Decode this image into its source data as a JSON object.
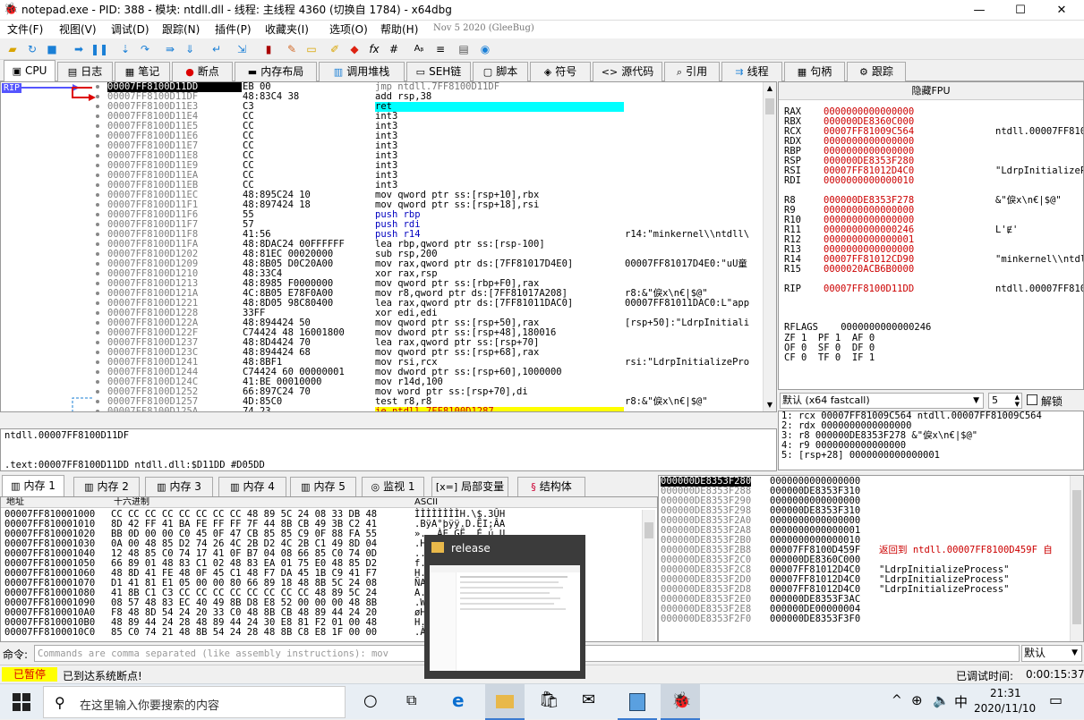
{
  "window": {
    "title": "notepad.exe - PID: 388 - 模块: ntdll.dll - 线程: 主线程 4360 (切换自 1784) - x64dbg",
    "minimize": "—",
    "maximize": "☐",
    "close": "✕"
  },
  "menu": [
    "文件(F)",
    "视图(V)",
    "调试(D)",
    "跟踪(N)",
    "插件(P)",
    "收藏夹(I)",
    "选项(O)",
    "帮助(H)"
  ],
  "build_date": "Nov 5 2020 (GleeBug)",
  "toolbar": [
    "open-folder-icon",
    "restart-icon",
    "stop-icon",
    "run-icon",
    "pause-icon",
    "step-into-icon",
    "step-over-icon",
    "trace-into-icon",
    "trace-over-icon",
    "execute-till-return-icon",
    "run-to-user-code-icon",
    "bookmark-icon",
    "comment-icon",
    "label-icon",
    "highlight-icon",
    "breakpoint-icon",
    "function-icon",
    "hash-icon",
    "font-icon",
    "align-icon",
    "script-icon",
    "calculator-icon"
  ],
  "tabs": [
    {
      "label": "CPU",
      "icon": "cpu-icon"
    },
    {
      "label": "日志",
      "icon": "log-icon"
    },
    {
      "label": "笔记",
      "icon": "notes-icon"
    },
    {
      "label": "断点",
      "icon": "breakpoint-icon"
    },
    {
      "label": "内存布局",
      "icon": "memory-map-icon"
    },
    {
      "label": "调用堆栈",
      "icon": "call-stack-icon"
    },
    {
      "label": "SEH链",
      "icon": "seh-icon"
    },
    {
      "label": "脚本",
      "icon": "script-icon"
    },
    {
      "label": "符号",
      "icon": "symbol-icon"
    },
    {
      "label": "源代码",
      "icon": "source-icon"
    },
    {
      "label": "引用",
      "icon": "references-icon"
    },
    {
      "label": "线程",
      "icon": "threads-icon"
    },
    {
      "label": "句柄",
      "icon": "handles-icon"
    },
    {
      "label": "跟踪",
      "icon": "trace-icon"
    }
  ],
  "cpu": {
    "rip_label": "RIP",
    "addresses": [
      "00007FF8100D11DD",
      "00007FF8100D11DF",
      "00007FF8100D11E3",
      "00007FF8100D11E4",
      "00007FF8100D11E5",
      "00007FF8100D11E6",
      "00007FF8100D11E7",
      "00007FF8100D11E8",
      "00007FF8100D11E9",
      "00007FF8100D11EA",
      "00007FF8100D11EB",
      "00007FF8100D11EC",
      "00007FF8100D11F1",
      "00007FF8100D11F6",
      "00007FF8100D11F7",
      "00007FF8100D11F8",
      "00007FF8100D11FA",
      "00007FF8100D1202",
      "00007FF8100D1209",
      "00007FF8100D1210",
      "00007FF8100D1213",
      "00007FF8100D121A",
      "00007FF8100D1221",
      "00007FF8100D1228",
      "00007FF8100D122A",
      "00007FF8100D122F",
      "00007FF8100D1237",
      "00007FF8100D123C",
      "00007FF8100D1241",
      "00007FF8100D1244",
      "00007FF8100D124C",
      "00007FF8100D1252",
      "00007FF8100D1257",
      "00007FF8100D125A"
    ],
    "bytes": [
      "EB 00",
      "48:83C4 38",
      "C3",
      "CC",
      "CC",
      "CC",
      "CC",
      "CC",
      "CC",
      "CC",
      "CC",
      "48:895C24 10",
      "48:897424 18",
      "55",
      "57",
      "41:56",
      "48:8DAC24 00FFFFFF",
      "48:81EC 00020000",
      "48:8B05 D0C20A00",
      "48:33C4",
      "48:8985 F0000000",
      "4C:8B05 E78F0A00",
      "48:8D05 98C80400",
      "33FF",
      "48:894424 50",
      "C74424 48 16001800",
      "48:8D4424 70",
      "48:894424 68",
      "48:8BF1",
      "C74424 60 00000001",
      "41:BE 00010000",
      "66:897C24 70",
      "4D:85C0",
      "74 23"
    ],
    "disasm": [
      "jmp ntdll.7FF8100D11DF",
      "add rsp,38",
      "ret",
      "int3",
      "int3",
      "int3",
      "int3",
      "int3",
      "int3",
      "int3",
      "int3",
      "mov qword ptr ss:[rsp+10],rbx",
      "mov qword ptr ss:[rsp+18],rsi",
      "push rbp",
      "push rdi",
      "push r14",
      "lea rbp,qword ptr ss:[rsp-100]",
      "sub rsp,200",
      "mov rax,qword ptr ds:[7FF81017D4E0]",
      "xor rax,rsp",
      "mov qword ptr ss:[rbp+F0],rax",
      "mov r8,qword ptr ds:[7FF81017A208]",
      "lea rax,qword ptr ds:[7FF81011DAC0]",
      "xor edi,edi",
      "mov qword ptr ss:[rsp+50],rax",
      "mov dword ptr ss:[rsp+48],180016",
      "lea rax,qword ptr ss:[rsp+70]",
      "mov qword ptr ss:[rsp+68],rax",
      "mov rsi,rcx",
      "mov dword ptr ss:[rsp+60],1000000",
      "mov r14d,100",
      "mov word ptr ss:[rsp+70],di",
      "test r8,r8",
      "je ntdll.7FF8100D1287"
    ],
    "comments": [
      "",
      "",
      "",
      "",
      "",
      "",
      "",
      "",
      "",
      "",
      "",
      "",
      "",
      "",
      "",
      "r14:\"minkernel\\\\ntdll\\",
      "",
      "",
      "00007FF81017D4E0:\"uU童",
      "",
      "",
      "r8:&\"㑦x\\n€|$@\"",
      "00007FF81011DAC0:L\"app",
      "",
      "[rsp+50]:\"LdrpInitiali",
      "",
      "",
      "",
      "rsi:\"LdrpInitializePro",
      "",
      "",
      "",
      "r8:&\"㑦x\\n€|$@\"",
      ""
    ]
  },
  "fpu_header": "隐藏FPU",
  "registers": [
    {
      "n": "RAX",
      "v": "0000000000000000",
      "c": ""
    },
    {
      "n": "RBX",
      "v": "000000DE8360C000",
      "c": ""
    },
    {
      "n": "RCX",
      "v": "00007FF81009C564",
      "c": "ntdll.00007FF81009C"
    },
    {
      "n": "RDX",
      "v": "0000000000000000",
      "c": ""
    },
    {
      "n": "RBP",
      "v": "0000000000000000",
      "c": ""
    },
    {
      "n": "RSP",
      "v": "000000DE8353F280",
      "c": ""
    },
    {
      "n": "RSI",
      "v": "00007FF81012D4C0",
      "c": "\"LdrpInitializeProc"
    },
    {
      "n": "RDI",
      "v": "0000000000000010",
      "c": ""
    },
    {
      "n": "R8",
      "v": "000000DE8353F278",
      "c": "&\"㑦x\\n€|$@\""
    },
    {
      "n": "R9",
      "v": "0000000000000000",
      "c": ""
    },
    {
      "n": "R10",
      "v": "0000000000000000",
      "c": ""
    },
    {
      "n": "R11",
      "v": "0000000000000246",
      "c": "L'Ɇ'"
    },
    {
      "n": "R12",
      "v": "0000000000000001",
      "c": ""
    },
    {
      "n": "R13",
      "v": "0000000000000000",
      "c": ""
    },
    {
      "n": "R14",
      "v": "00007FF81012CD90",
      "c": "\"minkernel\\\\ntdll\\\\"
    },
    {
      "n": "R15",
      "v": "0000020ACB6B0000",
      "c": ""
    },
    {
      "n": "RIP",
      "v": "00007FF8100D11DD",
      "c": "ntdll.00007FF8100D1"
    }
  ],
  "rflags": {
    "label": "RFLAGS",
    "value": "0000000000000246",
    "flags": [
      "ZF 1  PF 1  AF 0",
      "OF 0  SF 0  DF 0",
      "CF 0  TF 0  IF 1"
    ]
  },
  "callconv": {
    "selected": "默认 (x64 fastcall)",
    "count": "5",
    "unlock_label": "解锁"
  },
  "args": [
    "1: rcx 00007FF81009C564 ntdll.00007FF81009C564",
    "2: rdx 0000000000000000",
    "3: r8 000000DE8353F278 &\"㑦x\\n€|$@\"",
    "4: r9 0000000000000000",
    "5: [rsp+28] 0000000000000001"
  ],
  "info": {
    "line1": "ntdll.00007FF8100D11DF",
    "line2": ".text:00007FF8100D11DD ntdll.dll:$D11DD #D05DD"
  },
  "memtabs": [
    {
      "label": "内存 1",
      "icon": "dump-icon"
    },
    {
      "label": "内存 2",
      "icon": "dump-icon"
    },
    {
      "label": "内存 3",
      "icon": "dump-icon"
    },
    {
      "label": "内存 4",
      "icon": "dump-icon"
    },
    {
      "label": "内存 5",
      "icon": "dump-icon"
    },
    {
      "label": "监视 1",
      "icon": "watch-icon"
    },
    {
      "label": "局部变量",
      "icon": "locals-icon"
    },
    {
      "label": "结构体",
      "icon": "struct-icon"
    }
  ],
  "dump": {
    "headers": [
      "地址",
      "十六进制",
      "ASCII"
    ],
    "addresses": [
      "00007FF810001000",
      "00007FF810001010",
      "00007FF810001020",
      "00007FF810001030",
      "00007FF810001040",
      "00007FF810001050",
      "00007FF810001060",
      "00007FF810001070",
      "00007FF810001080",
      "00007FF810001090",
      "00007FF8100010A0",
      "00007FF8100010B0",
      "00007FF8100010C0"
    ],
    "hex": [
      "CC CC CC CC CC CC CC CC 48 89 5C 24 08 33 DB 48",
      "8D 42 FF 41 BA FE FF FF 7F 44 8B CB 49 3B C2 41",
      "BB 0D 00 00 C0 45 0F 47 CB 85 85 C9 0F 88 FA 55",
      "0A 00 48 85 D2 74 26 4C 2B D2 4C 2B C1 49 8D 04",
      "12 48 85 C0 74 17 41 0F B7 04 08 66 85 C0 74 0D",
      "66 89 01 48 83 C1 02 48 83 EA 01 75 E0 48 85 D2",
      "48 8D 41 FE 48 0F 45 C1 48 F7 DA 45 1B C9 41 F7",
      "D1 41 81 E1 05 00 00 80 66 89 18 48 8B 5C 24 08",
      "41 8B C1 C3 CC CC CC CC CC CC CC CC 48 89 5C 24",
      "08 57 48 83 EC 40 49 8B D8 E8 52 00 00 00 48 8B",
      "F8 48 8D 54 24 20 33 C0 48 8B CB 48 89 44 24 20",
      "48 89 44 24 28 48 89 44 24 30 E8 81 F2 01 00 48",
      "85 C0 74 21 48 8B 54 24 28 48 8B C8 E8 1F 00 00"
    ],
    "ascii": [
      "ÌÌÌÌÌÌÌÌH.\\$.3ÛH",
      ".BÿA°þÿÿ.D.ËI;ÂA",
      "»...ÀE.GË..É.ú U",
      ".H.ÒtóL+ÒL+ÁI..",
      "..H.Àt.A.·..f.Àt",
      "f..H.Á.H.ê.uàH.Ò",
      "H.AþH.EÁH÷ÚE.ÉA÷",
      "ÑA.á...f..H.\\$.",
      "A.ÁÃÌÌÌÌÌÌÌÌH.\\$",
      ".WH.ì@I.Øè R...H.",
      "øH.T$ 3ÀH.ËH.D$ ",
      "H.D$(H.D$0è.ò..H",
      ".Àt!H.T$(H.Èè..."
    ]
  },
  "stack": {
    "addresses": [
      "000000DE8353F280",
      "000000DE8353F288",
      "000000DE8353F290",
      "000000DE8353F298",
      "000000DE8353F2A0",
      "000000DE8353F2A8",
      "000000DE8353F2B0",
      "000000DE8353F2B8",
      "000000DE8353F2C0",
      "000000DE8353F2C8",
      "000000DE8353F2D0",
      "000000DE8353F2D8",
      "000000DE8353F2E0",
      "000000DE8353F2E8",
      "000000DE8353F2F0"
    ],
    "values": [
      "0000000000000000",
      "000000DE8353F310",
      "0000000000000000",
      "000000DE8353F310",
      "0000000000000000",
      "0000000000000001",
      "0000000000000010",
      "00007FF8100D459F",
      "000000DE8360C000",
      "00007FF81012D4C0",
      "00007FF81012D4C0",
      "00007FF81012D4C0",
      "000000DE8353F3AC",
      "000000DE00000004",
      "000000DE8353F3F0"
    ],
    "comments": [
      "",
      "",
      "",
      "",
      "",
      "",
      "",
      "返回到 ntdll.00007FF8100D459F 自",
      "",
      "\"LdrpInitializeProcess\"",
      "\"LdrpInitializeProcess\"",
      "\"LdrpInitializeProcess\"",
      "",
      "",
      ""
    ]
  },
  "command": {
    "label": "命令:",
    "placeholder": "Commands are comma separated (like assembly instructions): mov",
    "mode": "默认"
  },
  "status": {
    "state": "已暂停",
    "message": "已到达系统断点!",
    "time_label": "已调试时间:",
    "time": "0:00:15:37"
  },
  "popup": {
    "title": "release"
  },
  "taskbar": {
    "search": "在这里输入你要搜索的内容",
    "time": "21:31",
    "date": "2020/11/10",
    "ime": "中"
  }
}
